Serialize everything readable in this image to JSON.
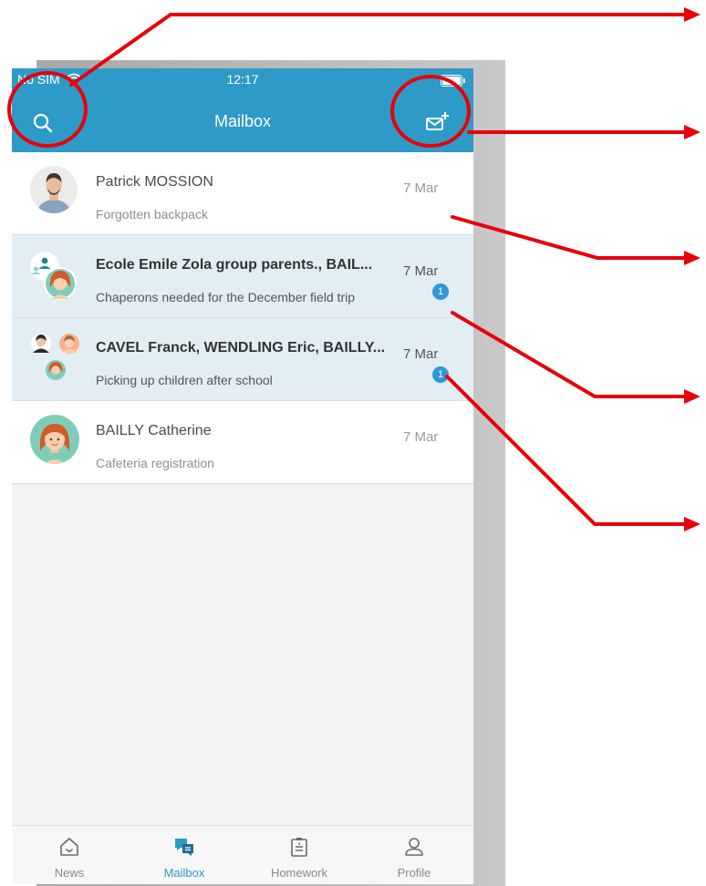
{
  "status_bar": {
    "carrier": "No SIM",
    "time": "12:17"
  },
  "header": {
    "title": "Mailbox",
    "search_icon": "search-icon",
    "compose_icon": "new-message-icon"
  },
  "messages": [
    {
      "sender": "Patrick MOSSION",
      "subject": "Forgotten backpack",
      "date": "7 Mar",
      "unread": false,
      "badge": ""
    },
    {
      "sender": "Ecole Emile Zola group parents., BAIL...",
      "subject": "Chaperons needed for the December field trip",
      "date": "7 Mar",
      "unread": true,
      "badge": "1"
    },
    {
      "sender": "CAVEL Franck, WENDLING Eric, BAILLY...",
      "subject": "Picking up children after school",
      "date": "7 Mar",
      "unread": true,
      "badge": "1"
    },
    {
      "sender": "BAILLY Catherine",
      "subject": "Cafeteria registration",
      "date": "7 Mar",
      "unread": false,
      "badge": ""
    }
  ],
  "tabs": [
    {
      "label": "News",
      "icon": "home-icon",
      "active": false
    },
    {
      "label": "Mailbox",
      "icon": "chat-icon",
      "active": true
    },
    {
      "label": "Homework",
      "icon": "homework-icon",
      "active": false
    },
    {
      "label": "Profile",
      "icon": "profile-icon",
      "active": false
    }
  ],
  "colors": {
    "header": "#2e9ac7",
    "unread_row": "#e3eef4",
    "badge": "#3197d6",
    "annotation": "#e8000b",
    "active_tab": "#2a9ac8"
  }
}
